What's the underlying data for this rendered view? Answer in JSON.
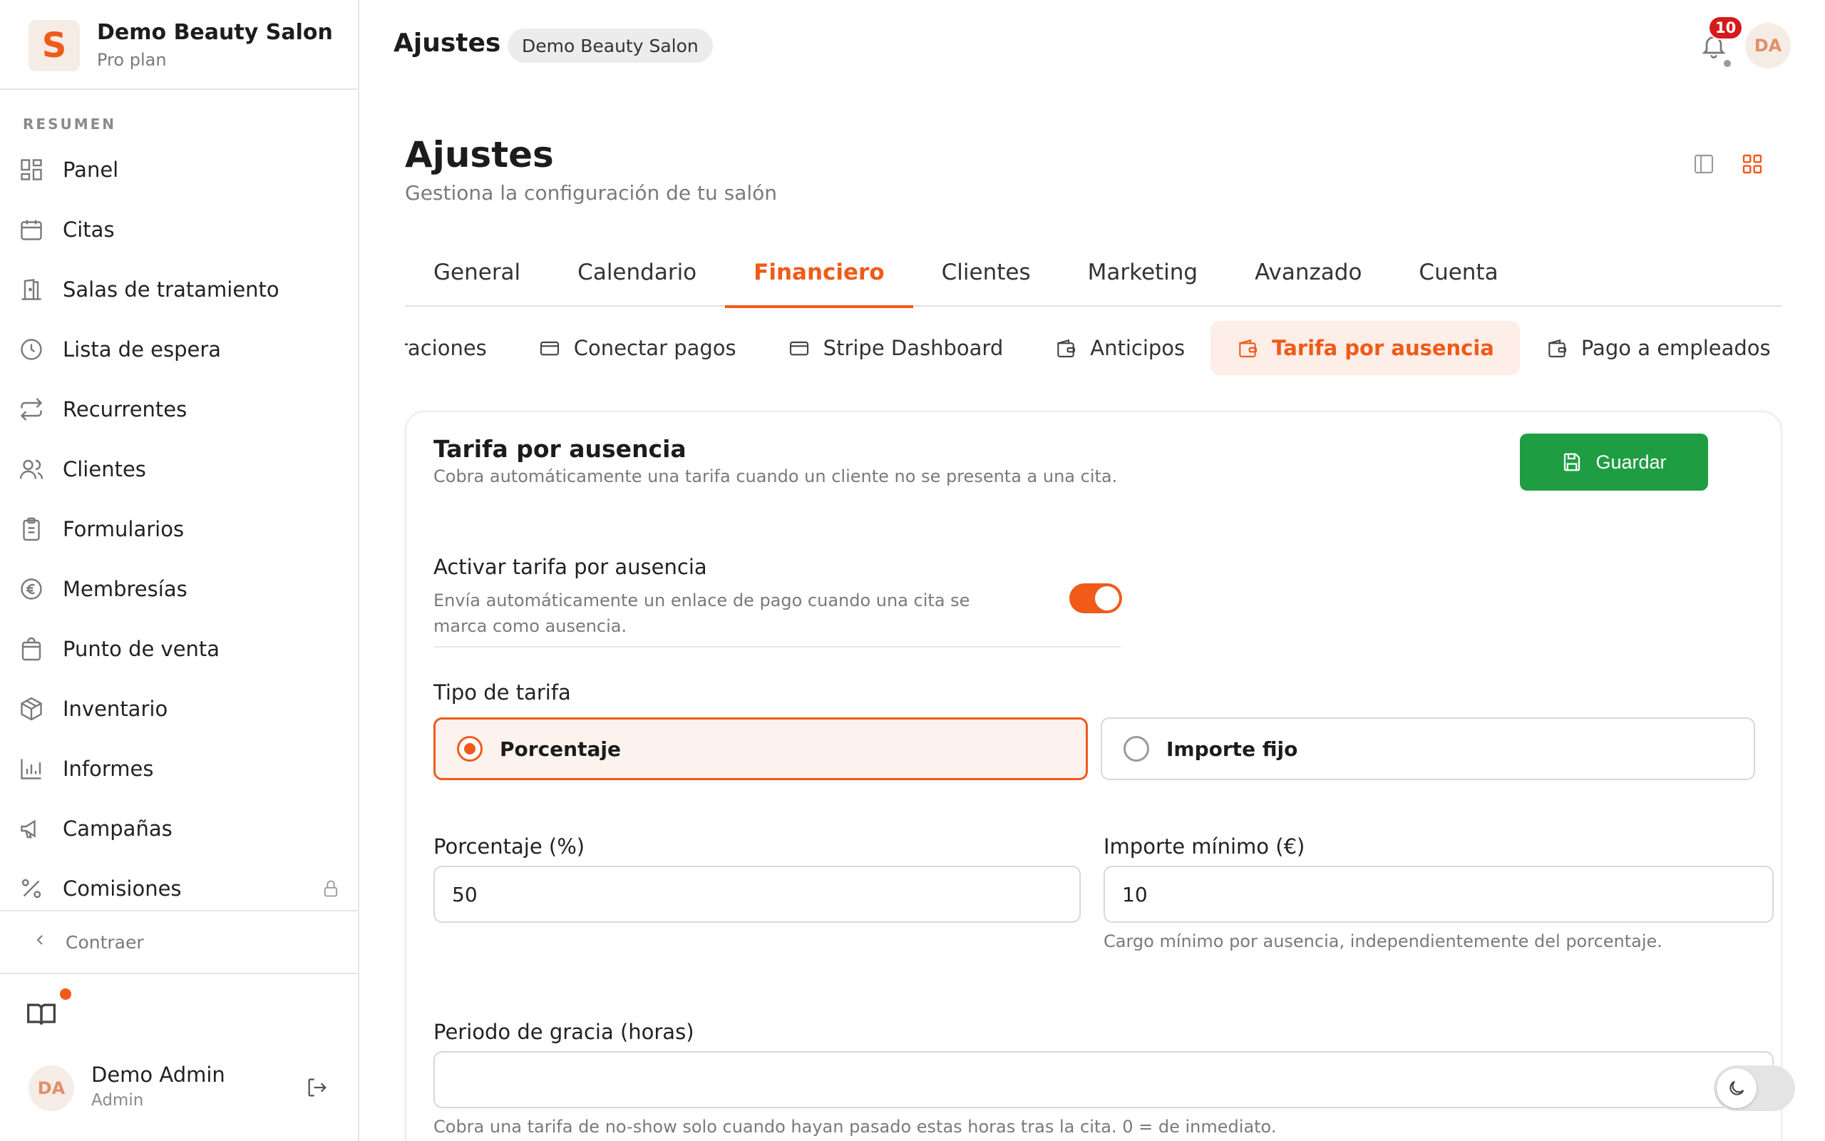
{
  "brand": {
    "name": "Demo Beauty Salon",
    "plan": "Pro plan",
    "logo_letter": "S",
    "accent": "#f05a1a"
  },
  "sidebar": {
    "section_label": "RESUMEN",
    "items": [
      {
        "label": "Panel",
        "icon": "dashboard-icon"
      },
      {
        "label": "Citas",
        "icon": "calendar-icon"
      },
      {
        "label": "Salas de tratamiento",
        "icon": "door-icon"
      },
      {
        "label": "Lista de espera",
        "icon": "clock-icon"
      },
      {
        "label": "Recurrentes",
        "icon": "repeat-icon"
      },
      {
        "label": "Clientes",
        "icon": "users-icon"
      },
      {
        "label": "Formularios",
        "icon": "clipboard-icon"
      },
      {
        "label": "Membresías",
        "icon": "euro-icon"
      },
      {
        "label": "Punto de venta",
        "icon": "shopping-bag-icon"
      },
      {
        "label": "Inventario",
        "icon": "package-icon"
      },
      {
        "label": "Informes",
        "icon": "bar-chart-icon"
      },
      {
        "label": "Campañas",
        "icon": "megaphone-icon"
      },
      {
        "label": "Comisiones",
        "icon": "percent-icon",
        "locked": true
      }
    ],
    "collapse_label": "Contraer"
  },
  "user": {
    "initials": "DA",
    "name": "Demo Admin",
    "role": "Admin"
  },
  "topbar": {
    "title": "Ajustes",
    "chip": "Demo Beauty Salon",
    "notification_count": "10",
    "avatar_initials": "DA"
  },
  "page": {
    "title": "Ajustes",
    "subtitle": "Gestiona la configuración de tu salón"
  },
  "tabs": [
    "General",
    "Calendario",
    "Financiero",
    "Clientes",
    "Marketing",
    "Avanzado",
    "Cuenta"
  ],
  "active_tab": "Financiero",
  "subtabs": [
    {
      "label": "raciones",
      "icon": ""
    },
    {
      "label": "Conectar pagos",
      "icon": "credit-card-icon"
    },
    {
      "label": "Stripe Dashboard",
      "icon": "credit-card-icon"
    },
    {
      "label": "Anticipos",
      "icon": "wallet-icon"
    },
    {
      "label": "Tarifa por ausencia",
      "icon": "wallet-icon",
      "active": true
    },
    {
      "label": "Pago a empleados",
      "icon": "wallet-icon",
      "locked": true
    }
  ],
  "card": {
    "title": "Tarifa por ausencia",
    "description": "Cobra automáticamente una tarifa cuando un cliente no se presenta a una cita.",
    "save_label": "Guardar",
    "save_color": "#1f9d42",
    "toggle_label": "Activar tarifa por ausencia",
    "toggle_description": "Envía automáticamente un enlace de pago cuando una cita se marca como ausencia.",
    "toggle_on": true,
    "fee_type_label": "Tipo de tarifa",
    "fee_type_options": [
      "Porcentaje",
      "Importe fijo"
    ],
    "fee_type_selected": "Porcentaje",
    "percentage_label": "Porcentaje (%)",
    "percentage_value": "50",
    "minimum_label": "Importe mínimo (€)",
    "minimum_value": "10",
    "minimum_hint": "Cargo mínimo por ausencia, independientemente del porcentaje.",
    "grace_label": "Periodo de gracia (horas)",
    "grace_value": "",
    "grace_hint": "Cobra una tarifa de no-show solo cuando hayan pasado estas horas tras la cita. 0 = de inmediato."
  }
}
